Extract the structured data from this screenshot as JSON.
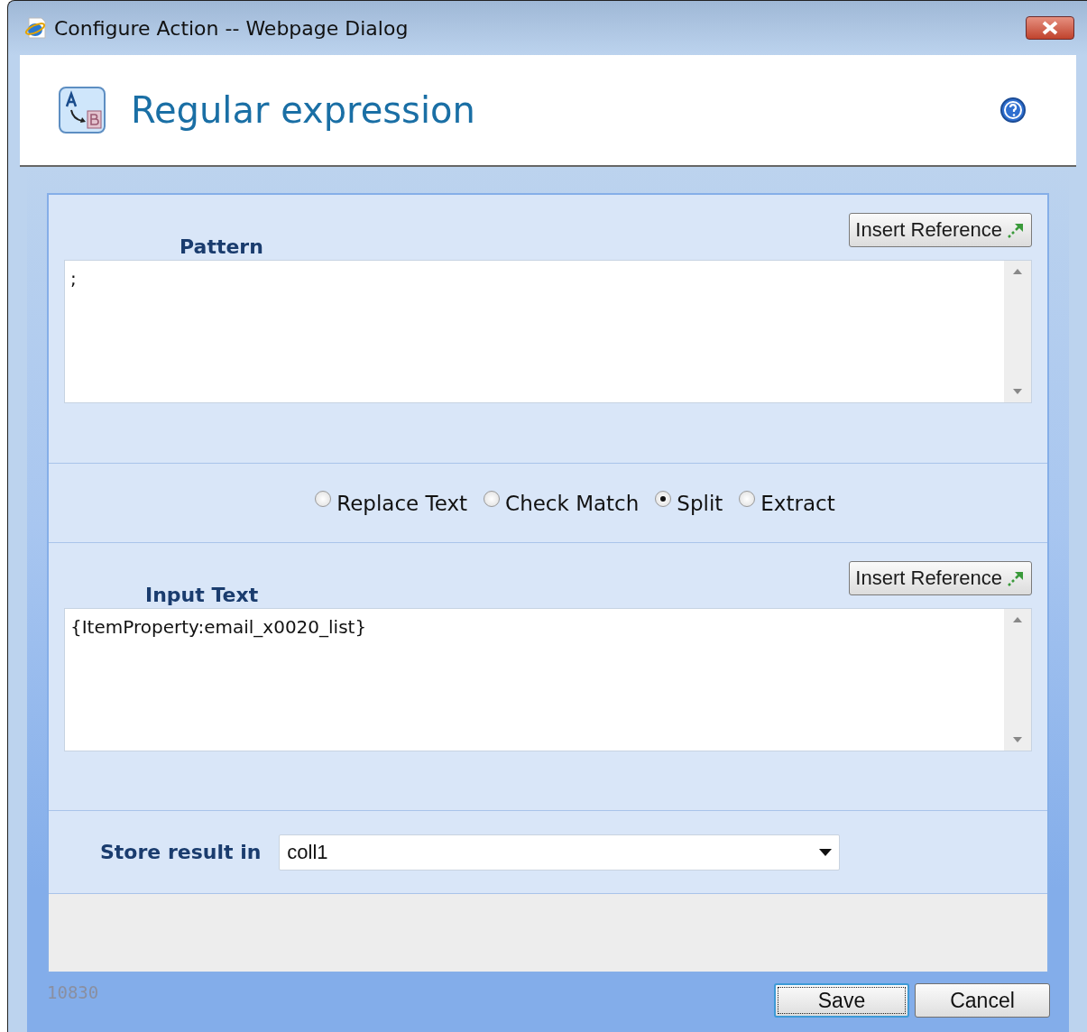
{
  "window": {
    "title": "Configure Action -- Webpage Dialog"
  },
  "header": {
    "title": "Regular expression"
  },
  "pattern": {
    "label": "Pattern",
    "button": "Insert Reference",
    "value": ";"
  },
  "modes": [
    {
      "label": "Replace Text",
      "selected": false
    },
    {
      "label": "Check Match",
      "selected": false
    },
    {
      "label": "Split",
      "selected": true
    },
    {
      "label": "Extract",
      "selected": false
    }
  ],
  "input_text": {
    "label": "Input Text",
    "button": "Insert Reference",
    "value": "{ItemProperty:email_x0020_list}"
  },
  "store_result": {
    "label": "Store result in",
    "value": "coll1"
  },
  "footer": {
    "code": "10830",
    "buttons": [
      "Save",
      "Cancel"
    ]
  }
}
